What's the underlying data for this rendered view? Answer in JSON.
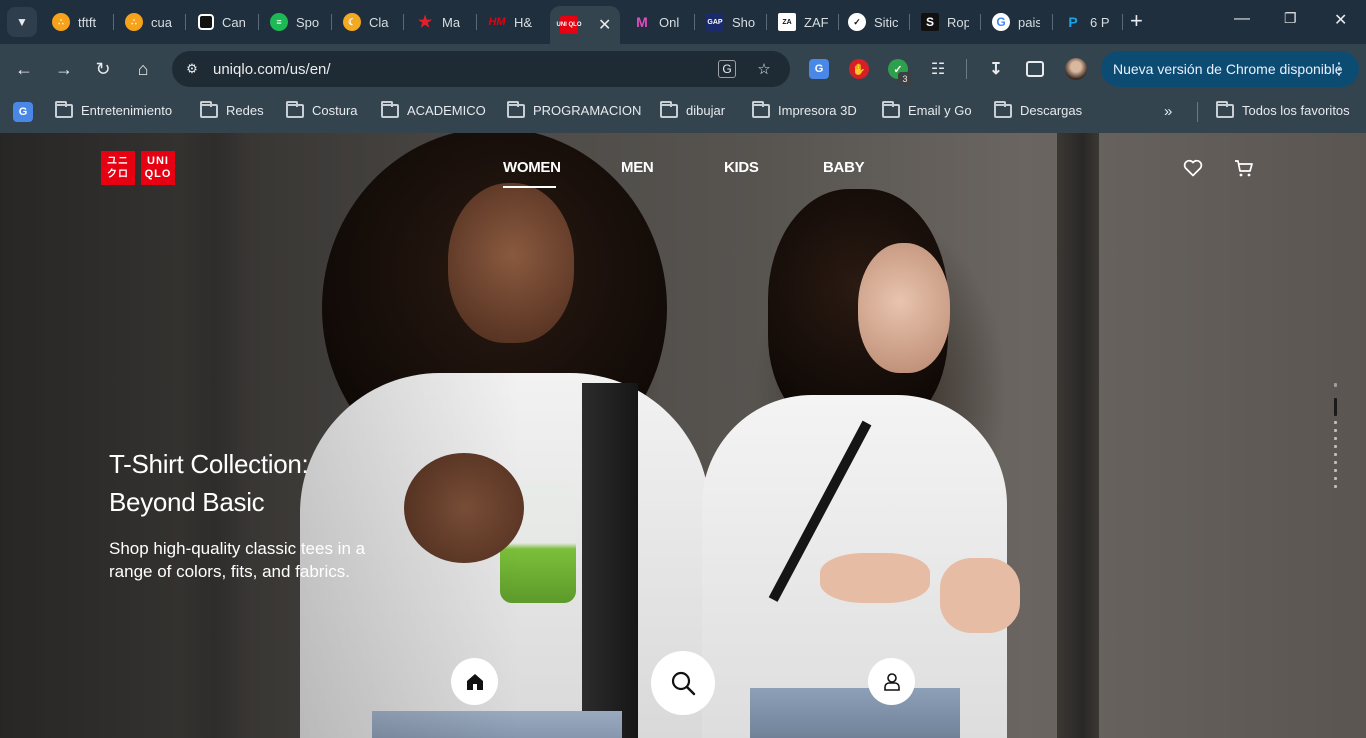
{
  "browser": {
    "tabs": [
      {
        "title": "tftft",
        "icon": "circles-icon",
        "color": "#f7a21b"
      },
      {
        "title": "cua",
        "icon": "circles-icon",
        "color": "#f7a21b"
      },
      {
        "title": "Can",
        "icon": "camera-icon",
        "color": "#ffffff"
      },
      {
        "title": "Spo",
        "icon": "spotify-icon",
        "color": "#1db954"
      },
      {
        "title": "Cla",
        "icon": "moon-icon",
        "color": "#f4a922"
      },
      {
        "title": "Ma",
        "icon": "star-icon",
        "color": "#e0202a"
      },
      {
        "title": "H&",
        "icon": "hm-icon",
        "color": "#e50010"
      },
      {
        "title": "",
        "icon": "uniqlo-icon",
        "color": "#e60012"
      },
      {
        "title": "Onl",
        "icon": "m-icon",
        "color": "#e04cc0"
      },
      {
        "title": "Sho",
        "icon": "gap-icon",
        "color": "#1b2a6b"
      },
      {
        "title": "ZAF",
        "icon": "zara-icon",
        "color": "#ffffff"
      },
      {
        "title": "Sitic",
        "icon": "nike-icon",
        "color": "#ffffff"
      },
      {
        "title": "Rop",
        "icon": "s-icon",
        "color": "#111111"
      },
      {
        "title": "pais",
        "icon": "google-icon",
        "color": "#ffffff"
      },
      {
        "title": "6 P",
        "icon": "p-icon",
        "color": "#1aa3e8"
      }
    ],
    "active_tab_label": "UNI QLO",
    "url": "uniqlo.com/us/en/",
    "update_label": "Nueva versión de Chrome disponible",
    "extension_badge": "3",
    "bookmarks": [
      {
        "label": "Entretenimiento"
      },
      {
        "label": "Redes"
      },
      {
        "label": "Costura"
      },
      {
        "label": "ACADEMICO"
      },
      {
        "label": "PROGRAMACION"
      },
      {
        "label": "dibujar"
      },
      {
        "label": "Impresora 3D"
      },
      {
        "label": "Email y Go"
      },
      {
        "label": "Descargas"
      }
    ],
    "all_bookmarks_label": "Todos los favoritos"
  },
  "site": {
    "logo_left": "UNI\nQLO",
    "logo_right": "UNI QLO",
    "nav": [
      {
        "label": "WOMEN",
        "selected": true
      },
      {
        "label": "MEN",
        "selected": false
      },
      {
        "label": "KIDS",
        "selected": false
      },
      {
        "label": "BABY",
        "selected": false
      }
    ],
    "hero": {
      "title_line1": "T-Shirt Collection:",
      "title_line2": "Beyond Basic",
      "subtitle": "Shop high-quality classic tees in a range of colors, fits, and fabrics."
    },
    "carousel": {
      "active_index": 0
    }
  }
}
